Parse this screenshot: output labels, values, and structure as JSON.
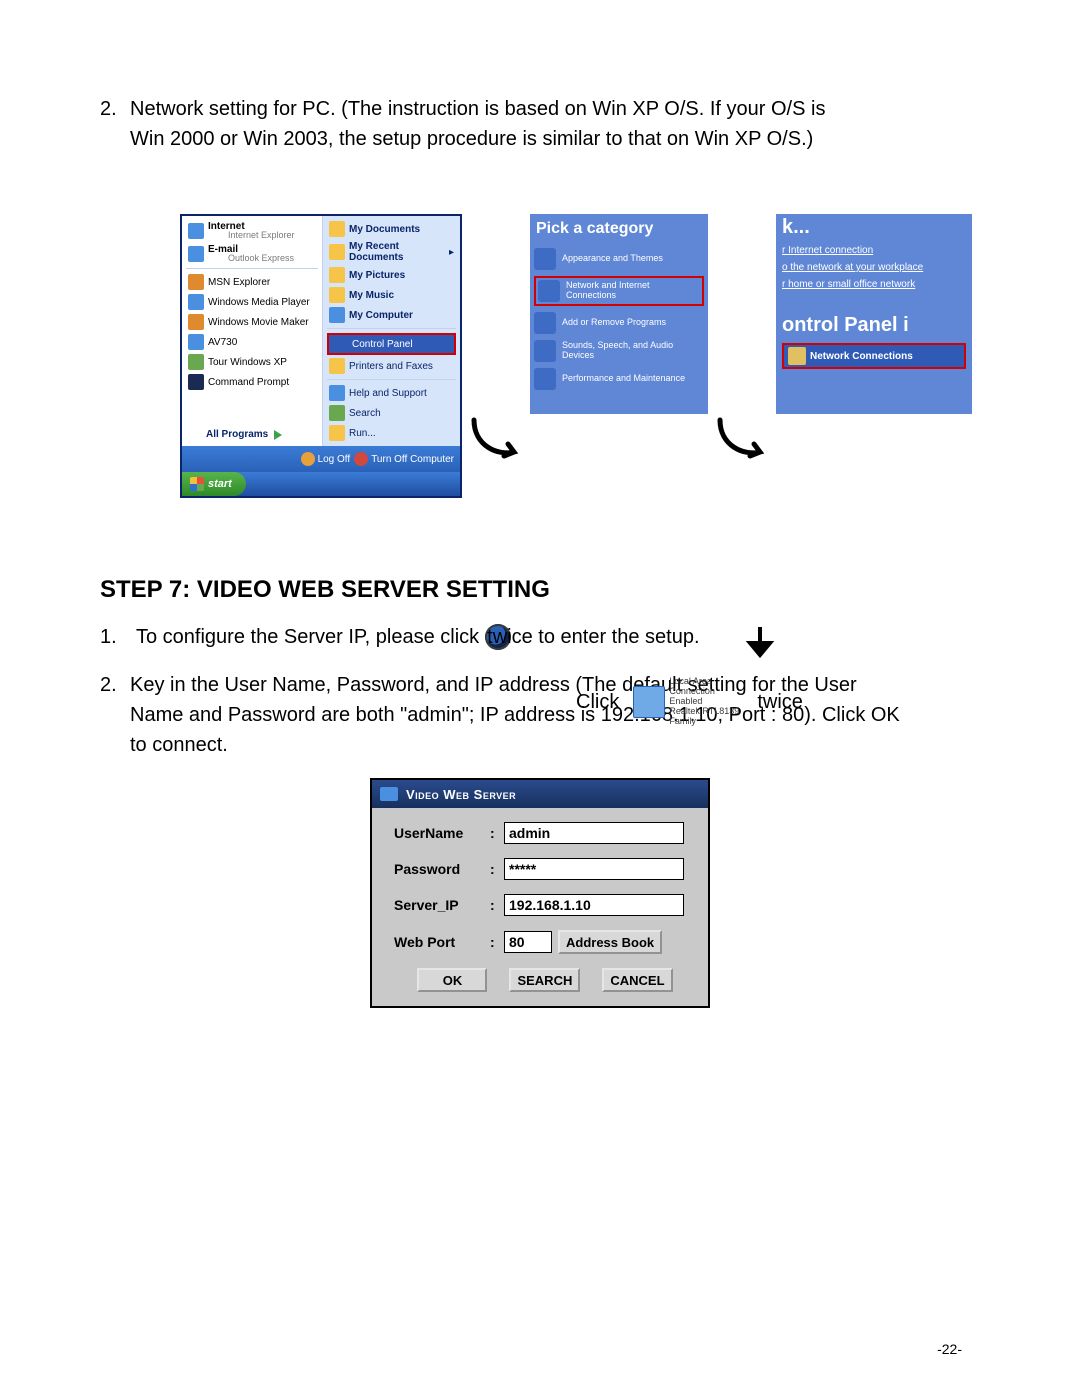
{
  "intro": {
    "num": "2.",
    "text_l1": "Network setting for PC.  (The instruction is based on Win XP O/S.  If your O/S is",
    "text_l2": "Win 2000 or Win 2003, the setup procedure is similar to that on Win XP O/S.)"
  },
  "start_menu": {
    "left": {
      "internet": "Internet",
      "internet_sub": "Internet Explorer",
      "email": "E-mail",
      "email_sub": "Outlook Express",
      "msn": "MSN Explorer",
      "wmp": "Windows Media Player",
      "wmm": "Windows Movie Maker",
      "av": "AV730",
      "tour": "Tour Windows XP",
      "cmd": "Command Prompt",
      "all": "All Programs"
    },
    "right": {
      "docs": "My Documents",
      "recent": "My Recent Documents",
      "pics": "My Pictures",
      "music": "My Music",
      "comp": "My Computer",
      "cp": "Control Panel",
      "printers": "Printers and Faxes",
      "help": "Help and Support",
      "search": "Search",
      "run": "Run..."
    },
    "footer": {
      "logoff": "Log Off",
      "turnoff": "Turn Off Computer",
      "start": "start"
    }
  },
  "cp": {
    "title": "Pick a category",
    "appearance": "Appearance and Themes",
    "net": "Network and Internet Connections",
    "addrem": "Add or Remove Programs",
    "sounds": "Sounds, Speech, and Audio Devices",
    "perf": "Performance and Maintenance"
  },
  "nettasks": {
    "k": "k...",
    "l1": "r Internet connection",
    "l2": "o the network at your workplace",
    "l3": "r home or small office network",
    "cp_icon_title": "ontrol Panel i",
    "nc": "Network Connections"
  },
  "lan": {
    "click": "Click",
    "name": "Local Area Connection",
    "status": "Enabled",
    "device": "Realtek RTL8139 Family",
    "twice": "twice"
  },
  "step7_heading": "STEP 7: VIDEO WEB SERVER SETTING",
  "step7_1": {
    "num": "1.",
    "before": "To configure the Server IP, please click",
    "after": "twice to enter the setup."
  },
  "step7_2": {
    "num": "2.",
    "l1": "Key in the User Name, Password, and IP address (The default setting for the User",
    "l2": "Name and Password are both \"admin\"; IP address is 192.168.1.10, Port : 80). Click OK",
    "l3": "to connect."
  },
  "dialog": {
    "title": "Video Web Server",
    "username_lbl": "UserName",
    "password_lbl": "Password",
    "serverip_lbl": "Server_IP",
    "webport_lbl": "Web Port",
    "username_val": "admin",
    "password_val": "*****",
    "serverip_val": "192.168.1.10",
    "webport_val": "80",
    "address_book": "Address Book",
    "ok": "OK",
    "search": "SEARCH",
    "cancel": "CANCEL"
  },
  "page_number": "-22-"
}
